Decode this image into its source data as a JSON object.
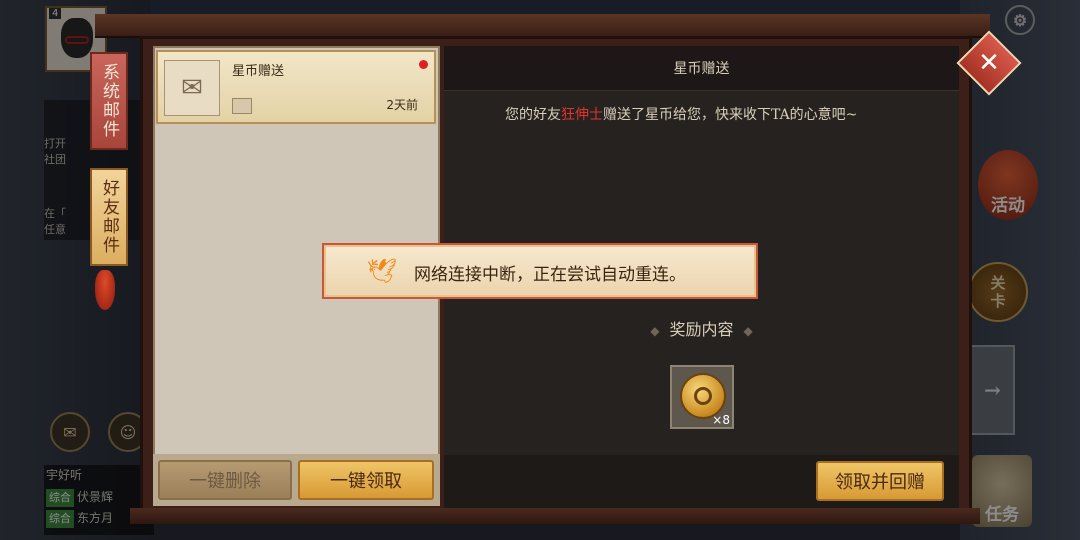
{
  "hud_left": {
    "avatar_level": "4",
    "chat_partial": [
      {
        "text": "打开"
      },
      {
        "text": "社团"
      },
      {
        "text": "在「"
      },
      {
        "text": "任意"
      }
    ],
    "chat_bottom": [
      {
        "tag": "",
        "text": "宇好听"
      },
      {
        "tag": "综合",
        "text": "伏景辉"
      },
      {
        "tag": "综合",
        "text": "东方月"
      }
    ]
  },
  "tabs": {
    "system": "系统邮件",
    "friend": "好友邮件"
  },
  "mail_list": {
    "items": [
      {
        "title": "星币赠送",
        "time": "2天前",
        "unread": true
      }
    ],
    "delete_all_label": "一键删除",
    "claim_all_label": "一键领取"
  },
  "detail": {
    "title": "星币赠送",
    "msg_before": "您的好友",
    "friend_name": "狂伸士",
    "msg_after": "赠送了星币给您，快来收下TA的心意吧~",
    "reward_heading": "奖励内容",
    "reward_count": "×8",
    "claim_return_label": "领取并回赠"
  },
  "toast": {
    "text": "网络连接中断，正在尝试自动重连。"
  },
  "hud_right": {
    "activity_label": "活动",
    "level_label_top": "关",
    "level_label_bottom": "卡",
    "task_label": "任务"
  },
  "colors": {
    "highlight_name": "#e0342a",
    "gold_button": "#d79a35",
    "frame": "#3c1f19",
    "toast_border": "#c7573a"
  }
}
